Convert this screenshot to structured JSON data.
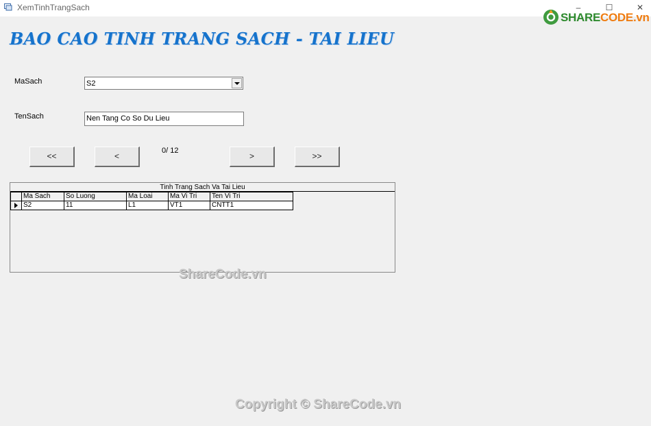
{
  "window": {
    "title": "XemTinhTrangSach",
    "minimize": "–",
    "maximize": "☐",
    "close": "✕"
  },
  "logo": {
    "share": "SHARE",
    "code": "CODE",
    "suffix": ".vn"
  },
  "heading": "BAO CAO TINH TRANG SACH - TAI LIEU",
  "form": {
    "masach_label": "MaSach",
    "masach_value": "S2",
    "tensach_label": "TenSach",
    "tensach_value": "Nen Tang Co So Du Lieu"
  },
  "nav": {
    "first": "<<",
    "prev": "<",
    "counter": "0/ 12",
    "next": ">",
    "last": ">>"
  },
  "grid": {
    "caption": "Tinh Trang Sach Va Tai Lieu",
    "columns": [
      "Ma Sach",
      "So Luong",
      "Ma Loai",
      "Ma Vi Tri",
      "Ten Vi Tri"
    ],
    "rows": [
      [
        "S2",
        "11",
        "L1",
        "VT1",
        "CNTT1"
      ]
    ]
  },
  "watermarks": {
    "center": "ShareCode.vn",
    "bottom": "Copyright © ShareCode.vn"
  },
  "colors": {
    "heading": "#1673cc",
    "logo_green": "#2e8a2e",
    "logo_orange": "#ef7d12"
  }
}
